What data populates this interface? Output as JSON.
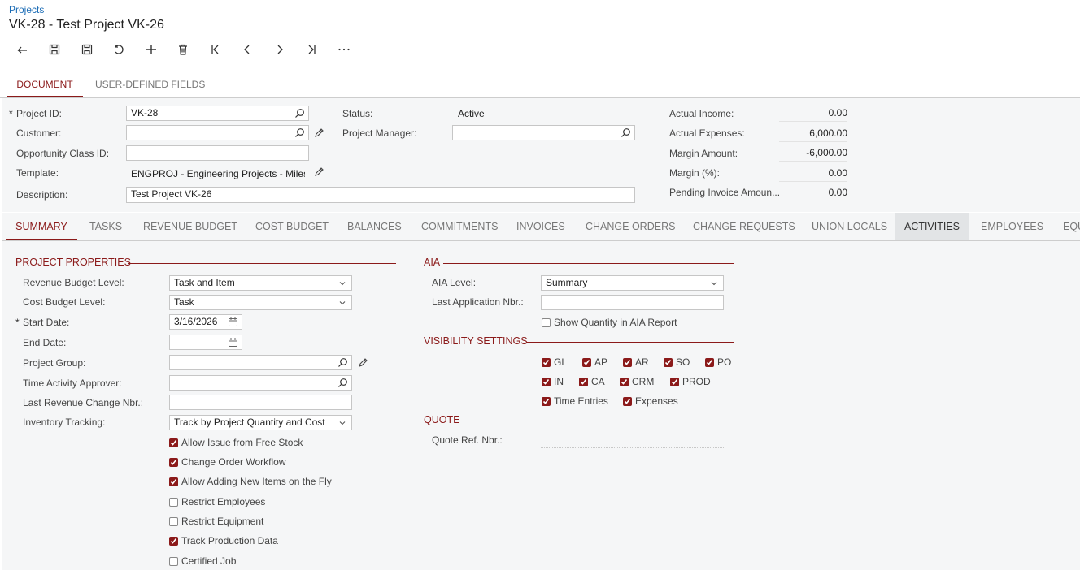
{
  "breadcrumb": "Projects",
  "title": "VK-28 - Test Project VK-26",
  "toolbar": [
    "back-icon",
    "save-close-icon",
    "save-icon",
    "undo-icon",
    "add-icon",
    "delete-icon",
    "first-icon",
    "previous-icon",
    "next-icon",
    "last-icon",
    "more-icon"
  ],
  "doc_tabs": [
    "DOCUMENT",
    "USER-DEFINED FIELDS"
  ],
  "header": {
    "project_id_label": "Project ID:",
    "project_id": "VK-28",
    "customer_label": "Customer:",
    "customer": "",
    "opportunity_label": "Opportunity Class ID:",
    "opportunity": "",
    "template_label": "Template:",
    "template": "ENGPROJ - Engineering Projects - Milest",
    "description_label": "Description:",
    "description": "Test Project VK-26",
    "status_label": "Status:",
    "status": "Active",
    "pm_label": "Project Manager:",
    "pm": "",
    "actual_income_label": "Actual Income:",
    "actual_income": "0.00",
    "actual_expenses_label": "Actual Expenses:",
    "actual_expenses": "6,000.00",
    "margin_amount_label": "Margin Amount:",
    "margin_amount": "-6,000.00",
    "margin_pct_label": "Margin (%):",
    "margin_pct": "0.00",
    "pending_label": "Pending Invoice Amoun...",
    "pending": "0.00"
  },
  "tabs": [
    "SUMMARY",
    "TASKS",
    "REVENUE BUDGET",
    "COST BUDGET",
    "BALANCES",
    "COMMITMENTS",
    "INVOICES",
    "CHANGE ORDERS",
    "CHANGE REQUESTS",
    "UNION LOCALS",
    "ACTIVITIES",
    "EMPLOYEES",
    "EQU"
  ],
  "props": {
    "section": "PROJECT PROPERTIES",
    "rev_level_label": "Revenue Budget Level:",
    "rev_level": "Task and Item",
    "cost_level_label": "Cost Budget Level:",
    "cost_level": "Task",
    "start_label": "Start Date:",
    "start": "3/16/2026",
    "end_label": "End Date:",
    "end": "",
    "group_label": "Project Group:",
    "approver_label": "Time Activity Approver:",
    "last_rev_label": "Last Revenue Change Nbr.:",
    "inv_label": "Inventory Tracking:",
    "inv": "Track by Project Quantity and Cost",
    "checks": [
      {
        "label": "Allow Issue from Free Stock",
        "checked": true
      },
      {
        "label": "Change Order Workflow",
        "checked": true
      },
      {
        "label": "Allow Adding New Items on the Fly",
        "checked": true
      },
      {
        "label": "Restrict Employees",
        "checked": false
      },
      {
        "label": "Restrict Equipment",
        "checked": false
      },
      {
        "label": "Track Production Data",
        "checked": true
      },
      {
        "label": "Certified Job",
        "checked": false
      }
    ]
  },
  "aia": {
    "section": "AIA",
    "level_label": "AIA Level:",
    "level": "Summary",
    "last_app_label": "Last Application Nbr.:",
    "show_qty": "Show Quantity in AIA Report"
  },
  "visibility": {
    "section": "VISIBILITY SETTINGS",
    "row1": [
      "GL",
      "AP",
      "AR",
      "SO",
      "PO"
    ],
    "row2": [
      "IN",
      "CA",
      "CRM",
      "PROD"
    ],
    "row3": [
      "Time Entries",
      "Expenses"
    ]
  },
  "quote": {
    "section": "QUOTE",
    "ref_label": "Quote Ref. Nbr.:"
  },
  "colors": {
    "accent": "#8b1a1a",
    "link": "#1a6bb5"
  }
}
